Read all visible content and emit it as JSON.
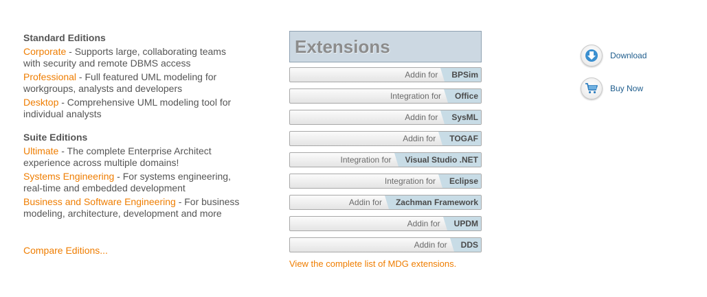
{
  "standard": {
    "title": "Standard Editions",
    "items": [
      {
        "name": "Corporate",
        "desc": " - Supports large, collaborating teams with security and remote DBMS access"
      },
      {
        "name": "Professional",
        "desc": " - Full featured UML modeling for workgroups, analysts and developers"
      },
      {
        "name": "Desktop",
        "desc": " - Comprehensive UML modeling tool for individual analysts"
      }
    ]
  },
  "suite": {
    "title": "Suite Editions",
    "items": [
      {
        "name": "Ultimate",
        "desc": " - The complete Enterprise Architect experience across multiple domains!"
      },
      {
        "name": "Systems Engineering",
        "desc": " - For systems engineering, real-time and embedded development"
      },
      {
        "name": "Business and Software Engineering",
        "desc": " - For business modeling, architecture, development and more"
      }
    ]
  },
  "compare_link": "Compare Editions...",
  "extensions": {
    "title": "Extensions",
    "items": [
      {
        "prefix": "Addin for",
        "name": "BPSim"
      },
      {
        "prefix": "Integration for",
        "name": "Office"
      },
      {
        "prefix": "Addin for",
        "name": "SysML"
      },
      {
        "prefix": "Addin for",
        "name": "TOGAF"
      },
      {
        "prefix": "Integration for",
        "name": "Visual Studio .NET"
      },
      {
        "prefix": "Integration for",
        "name": "Eclipse"
      },
      {
        "prefix": "Addin for",
        "name": "Zachman Framework"
      },
      {
        "prefix": "Addin for",
        "name": "UPDM"
      },
      {
        "prefix": "Addin for",
        "name": "DDS"
      }
    ],
    "view_all": "View the complete list of MDG extensions."
  },
  "actions": {
    "download": {
      "label": "Download",
      "icon": "download-arrow-icon"
    },
    "buy": {
      "label": "Buy Now",
      "icon": "shopping-cart-icon"
    }
  },
  "colors": {
    "link": "#ef7d00",
    "text": "#555555",
    "accent_blue": "#1d5c8c"
  }
}
